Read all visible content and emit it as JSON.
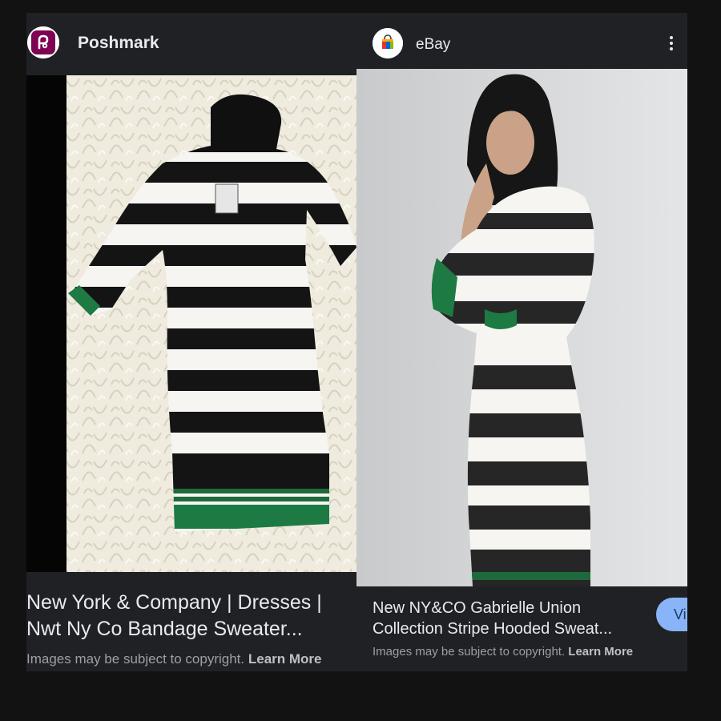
{
  "results": [
    {
      "source": "Poshmark",
      "logo_icon": "poshmark-logo-icon",
      "title_lines": [
        "New York & Company | Dresses |",
        "Nwt Ny Co Bandage Sweater..."
      ],
      "copyright_text": "Images may be subject to copyright.",
      "learn_more": "Learn More",
      "image_icon": "striped-dress-on-fur-photo"
    },
    {
      "source": "eBay",
      "logo_icon": "ebay-bag-logo-icon",
      "title_lines": [
        "New NY&CO Gabrielle Union",
        "Collection Stripe Hooded Sweat..."
      ],
      "copyright_text": "Images may be subject to copyright.",
      "learn_more": "Learn More",
      "visit_label": "Vi",
      "image_icon": "model-wearing-striped-dress-photo"
    }
  ],
  "colors": {
    "background": "#121212",
    "card": "#202124",
    "poshmark_brand": "#7f0353",
    "visit_button": "#8ab4f8"
  }
}
